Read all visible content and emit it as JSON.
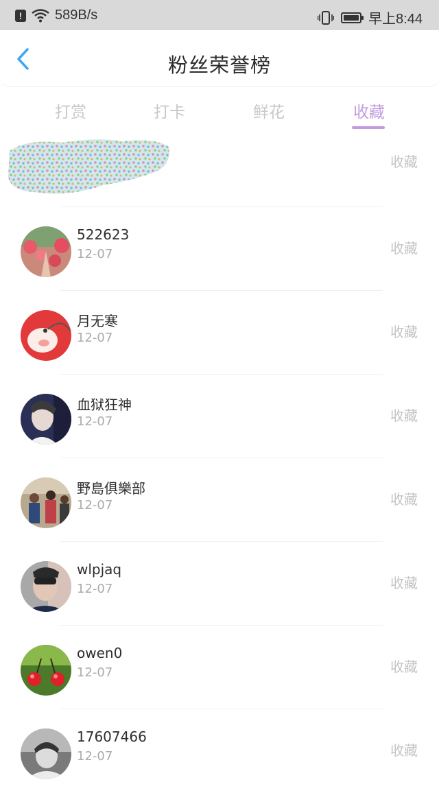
{
  "status_bar": {
    "speed": "589B/s",
    "time": "早上8:44"
  },
  "header": {
    "title": "粉丝荣誉榜"
  },
  "tabs": [
    {
      "label": "打赏"
    },
    {
      "label": "打卡"
    },
    {
      "label": "鲜花"
    },
    {
      "label": "收藏"
    }
  ],
  "active_tab": "收藏",
  "first_row": {
    "action": "收藏"
  },
  "rows": [
    {
      "name": "522623",
      "date": "12-07",
      "action": "收藏"
    },
    {
      "name": "月无寒",
      "date": "12-07",
      "action": "收藏"
    },
    {
      "name": "血狱狂神",
      "date": "12-07",
      "action": "收藏"
    },
    {
      "name": "野島俱樂部",
      "date": "12-07",
      "action": "收藏"
    },
    {
      "name": "wlpjaq",
      "date": "12-07",
      "action": "收藏"
    },
    {
      "name": "owen0",
      "date": "12-07",
      "action": "收藏"
    },
    {
      "name": "17607466",
      "date": "12-07",
      "action": "收藏"
    }
  ],
  "colors": {
    "accent": "#c39be0",
    "back_arrow": "#3fa7f2",
    "status_bar_bg": "#d9d9d9"
  }
}
